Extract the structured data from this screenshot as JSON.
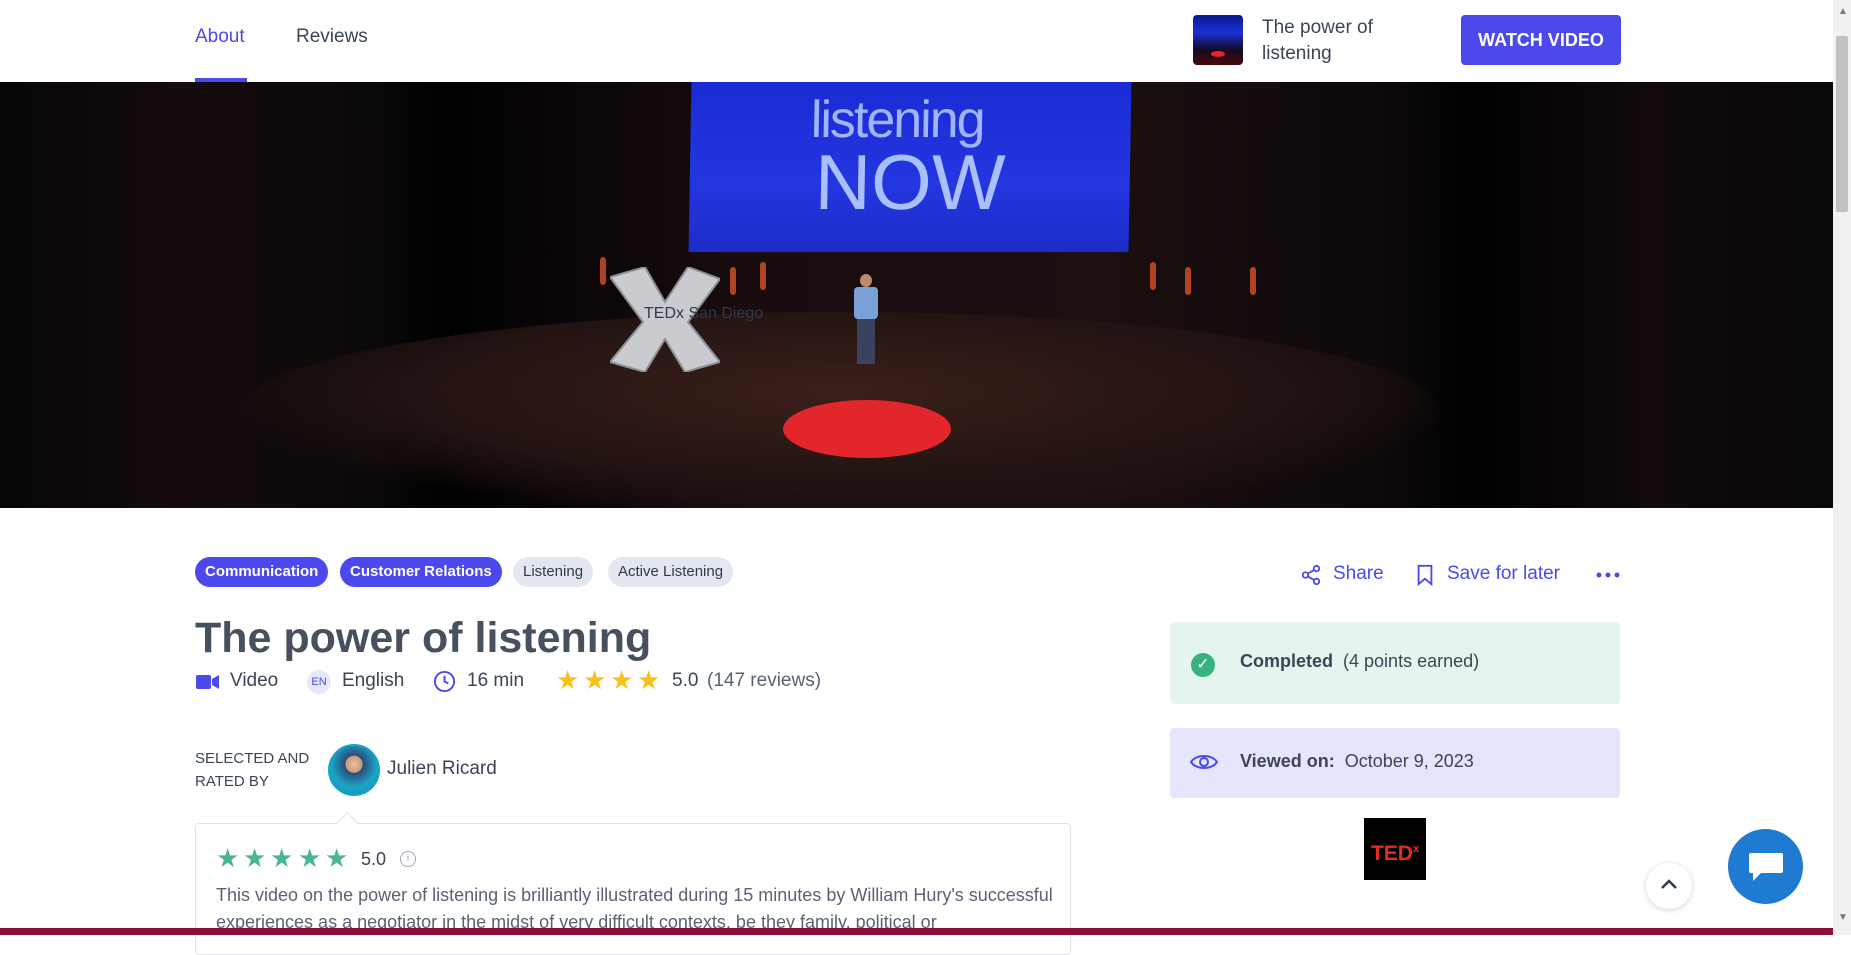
{
  "nav": {
    "tabs": [
      {
        "label": "About",
        "active": true
      },
      {
        "label": "Reviews",
        "active": false
      }
    ],
    "mini_title": "The power of listening",
    "watch_button": "WATCH VIDEO"
  },
  "hero": {
    "screen_line1": "listening",
    "screen_line2": "NOW",
    "stage_logo_text": "TEDx San Diego"
  },
  "tags": [
    {
      "label": "Communication",
      "style": "primary"
    },
    {
      "label": "Customer Relations",
      "style": "primary"
    },
    {
      "label": "Listening",
      "style": "secondary"
    },
    {
      "label": "Active Listening",
      "style": "secondary"
    }
  ],
  "actions": {
    "share": "Share",
    "save": "Save for later",
    "more_icon": "more-horizontal-icon"
  },
  "content": {
    "title": "The power of listening",
    "type": "Video",
    "language_code": "EN",
    "language": "English",
    "duration": "16 min",
    "rating": "5.0",
    "rating_stars": 4,
    "reviews": "(147 reviews)"
  },
  "curator": {
    "label": "SELECTED AND RATED BY",
    "name": "Julien Ricard"
  },
  "curator_review": {
    "stars": 5,
    "score": "5.0",
    "text": "This video on the power of listening is brilliantly illustrated during 15 minutes by William Hury's successful experiences as a negotiator in the midst of very difficult contexts, be they family, political or"
  },
  "status": {
    "completed_label": "Completed",
    "completed_points": "(4 points earned)",
    "viewed_label": "Viewed on:",
    "viewed_date": "October 9, 2023"
  },
  "provider": {
    "logo_text": "TED",
    "logo_sup": "x"
  },
  "colors": {
    "accent": "#4b48ec",
    "completed_bg": "#e6f4ef",
    "viewed_bg": "#e5e5fb",
    "star": "#f6c21a",
    "curator_star": "#4bb497"
  }
}
